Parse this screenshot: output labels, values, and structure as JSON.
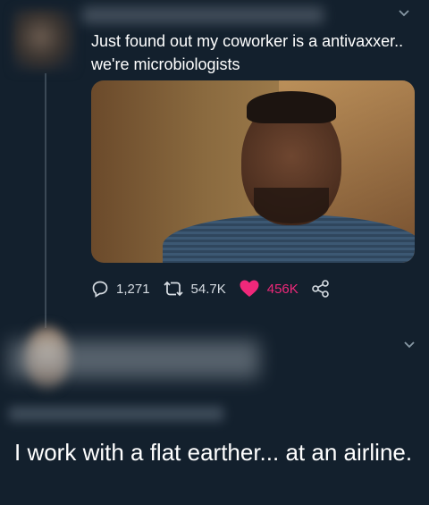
{
  "tweet": {
    "text": "Just found out my coworker is a antivaxxer.. we're microbiologists",
    "media_description_icon": "gif-frame-image",
    "stats": {
      "replies": "1,271",
      "retweets": "54.7K",
      "likes": "456K"
    }
  },
  "reply": {
    "text": "I work with a flat earther... at an airline."
  },
  "colors": {
    "background": "#13202d",
    "like_pink": "#f0287a",
    "text": "#ffffff",
    "muted": "#d7dde3"
  }
}
